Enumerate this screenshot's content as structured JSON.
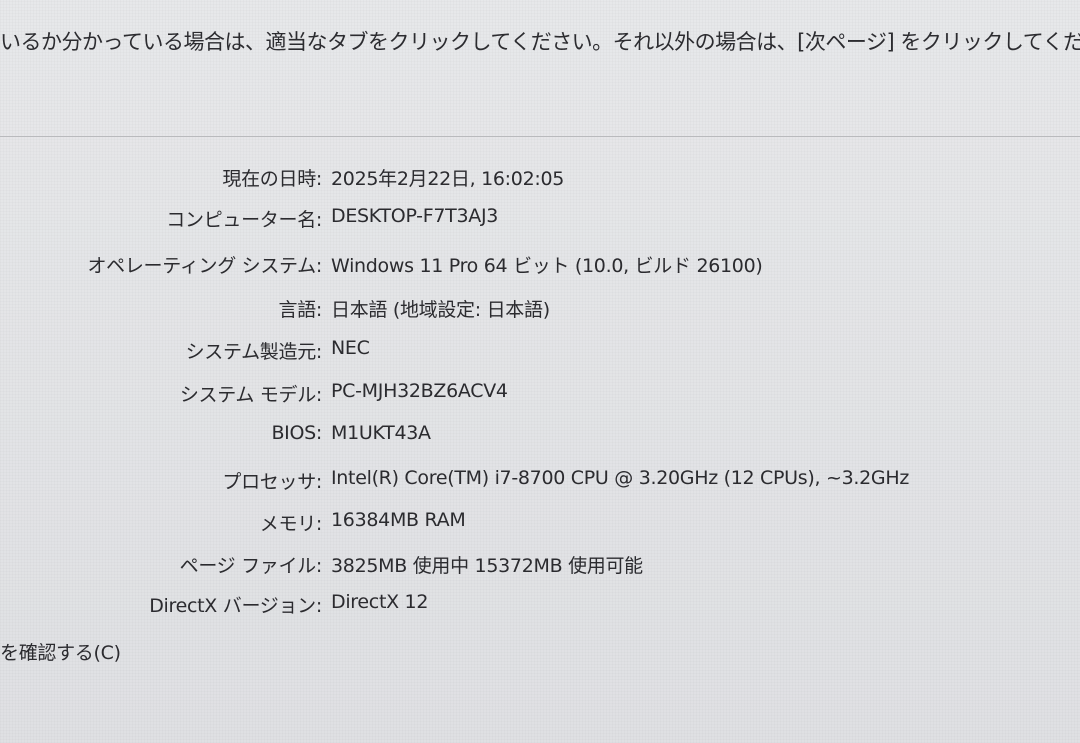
{
  "header": {
    "instruction": "いるか分かっている場合は、適当なタブをクリックしてください。それ以外の場合は、[次ページ] をクリックしてください。"
  },
  "system_info": [
    {
      "label": "現在の日時:",
      "value": "2025年2月22日, 16:02:05"
    },
    {
      "label": "コンピューター名:",
      "value": "DESKTOP-F7T3AJ3"
    },
    {
      "label": "オペレーティング システム:",
      "value": "Windows 11 Pro 64 ビット (10.0, ビルド 26100)"
    },
    {
      "label": "言語:",
      "value": "日本語 (地域設定: 日本語)"
    },
    {
      "label": "システム製造元:",
      "value": "NEC"
    },
    {
      "label": "システム モデル:",
      "value": "PC-MJH32BZ6ACV4"
    },
    {
      "label": "BIOS:",
      "value": "M1UKT43A"
    },
    {
      "label": "プロセッサ:",
      "value": "Intel(R) Core(TM) i7-8700 CPU @ 3.20GHz (12 CPUs), ~3.2GHz"
    },
    {
      "label": "メモリ:",
      "value": "16384MB RAM"
    },
    {
      "label": "ページ ファイル:",
      "value": "3825MB 使用中 15372MB 使用可能"
    },
    {
      "label": "DirectX バージョン:",
      "value": "DirectX 12"
    }
  ],
  "footer": {
    "check_label": "を確認する(C)"
  }
}
